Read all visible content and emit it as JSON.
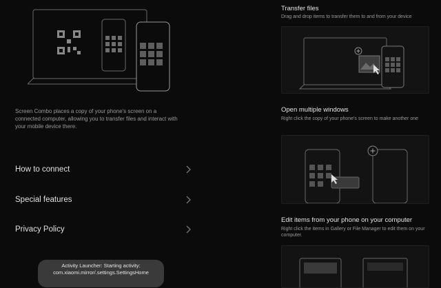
{
  "intro": {
    "description": "Screen Combo places a copy of your phone's screen on a connected computer, allowing you to transfer files and interact with your mobile device there."
  },
  "menu": [
    {
      "label": "How to connect",
      "icon": "chevron-right-icon"
    },
    {
      "label": "Special features",
      "icon": "chevron-right-icon"
    },
    {
      "label": "Privacy Policy",
      "icon": "chevron-right-icon"
    }
  ],
  "toast": {
    "line1": "Activity Launcher: Starting activity:",
    "line2": "com.xiaomi.mirror/.settings.SettingsHome"
  },
  "sections": [
    {
      "title": "Transfer files",
      "description": "Drag and drop items to transfer them to and from your device"
    },
    {
      "title": "Open multiple windows",
      "description": "Right click the copy of your phone's screen to make another one"
    },
    {
      "title": "Edit items from your phone on your computer",
      "description": "Right click the items in Gallery or File Manager to edit them on your computer."
    }
  ],
  "colors": {
    "background": "#0b0b0b",
    "card": "#131313",
    "toast": "#3a3a3a"
  }
}
